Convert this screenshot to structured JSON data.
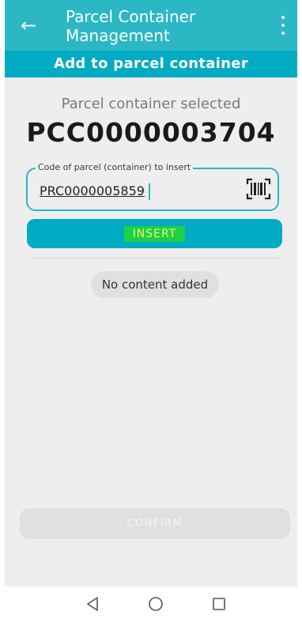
{
  "app_bar": {
    "title": "Parcel Container Management",
    "back_icon": "arrow-left-icon",
    "menu_icon": "more-vert-icon",
    "color": "#2bb7c4"
  },
  "sub_header": {
    "title": "Add to parcel container",
    "color": "#00abc3"
  },
  "selection": {
    "label": "Parcel container selected",
    "code": "PCC0000003704"
  },
  "code_field": {
    "label": "Code of parcel (container) to insert",
    "value": "PRC0000005859",
    "scan_icon": "barcode-scan-icon"
  },
  "insert_button": {
    "label": "INSERT"
  },
  "content_list": {
    "empty_text": "No content added"
  },
  "confirm_button": {
    "label": "CONFIRM",
    "state": "disabled"
  },
  "system_nav": {
    "back_icon": "nav-back-triangle-icon",
    "home_icon": "nav-home-circle-icon",
    "recents_icon": "nav-recents-square-icon"
  }
}
